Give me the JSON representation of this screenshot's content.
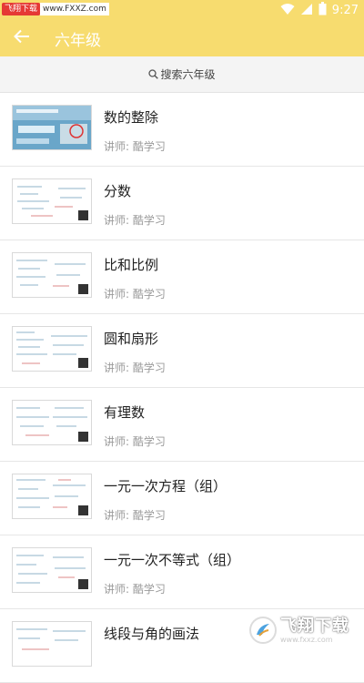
{
  "status_bar": {
    "time": "9:27",
    "watermark_label": "飞翔下载",
    "watermark_url": "www.FXXZ.com"
  },
  "app_bar": {
    "title": "六年级",
    "back_icon": "back-arrow-icon"
  },
  "search": {
    "label": "搜索六年级",
    "icon": "search-icon"
  },
  "courses": [
    {
      "title": "数的整除",
      "teacher": "讲师: 酷学习",
      "thumb": "photo"
    },
    {
      "title": "分数",
      "teacher": "讲师: 酷学习",
      "thumb": "notes"
    },
    {
      "title": "比和比例",
      "teacher": "讲师: 酷学习",
      "thumb": "notes"
    },
    {
      "title": "圆和扇形",
      "teacher": "讲师: 酷学习",
      "thumb": "notes"
    },
    {
      "title": "有理数",
      "teacher": "讲师: 酷学习",
      "thumb": "notes"
    },
    {
      "title": "一元一次方程（组）",
      "teacher": "讲师: 酷学习",
      "thumb": "notes"
    },
    {
      "title": "一元一次不等式（组）",
      "teacher": "讲师: 酷学习",
      "thumb": "notes"
    },
    {
      "title": "线段与角的画法",
      "teacher": "",
      "thumb": "notes"
    }
  ],
  "bottom_watermark": {
    "name": "飞翔下载",
    "url": "www.fxxz.com"
  },
  "colors": {
    "accent": "#f7dc6f",
    "divider": "#e6e6e6",
    "teacher_text": "#9a9a9a"
  }
}
